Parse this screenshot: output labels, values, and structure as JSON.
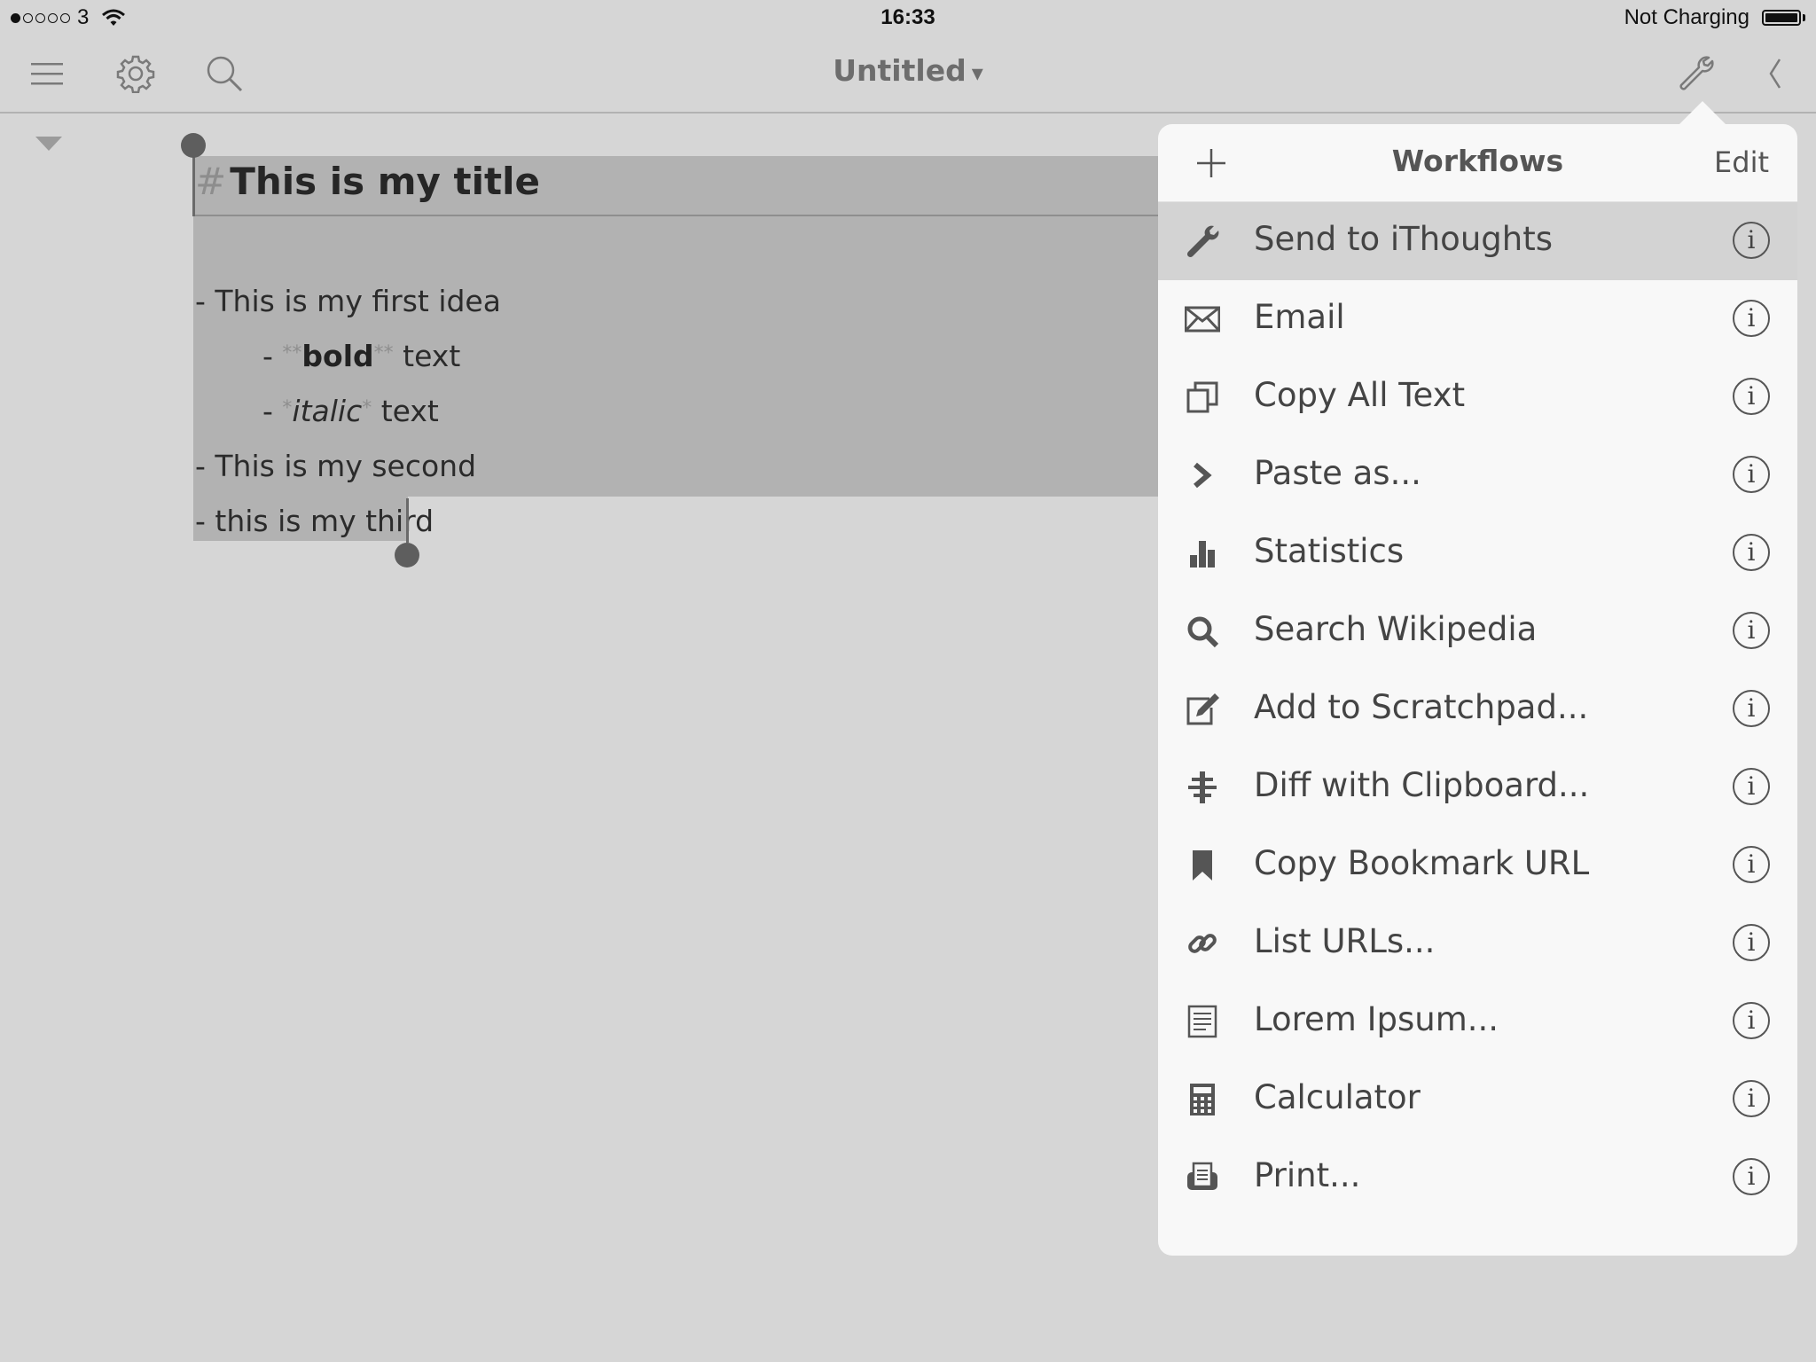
{
  "status_bar": {
    "carrier": "3",
    "time": "16:33",
    "battery_text": "Not Charging"
  },
  "toolbar": {
    "doc_title": "Untitled",
    "title_caret": "▾"
  },
  "editor": {
    "heading_marker": "#",
    "heading": "This is my title",
    "line1": "- This is my first idea",
    "line2_dash": "- ",
    "line2_mark_open": "**",
    "line2_bold": "bold",
    "line2_mark_close": "**",
    "line2_rest": " text",
    "line3_dash": "- ",
    "line3_mark_open": "*",
    "line3_italic": "italic",
    "line3_mark_close": "*",
    "line3_rest": " text",
    "line4": "- This is my second",
    "line5": "- this is my third"
  },
  "popover": {
    "title": "Workflows",
    "edit_label": "Edit",
    "info_glyph": "i",
    "items": [
      {
        "label": "Send to iThoughts",
        "icon": "wrench-icon"
      },
      {
        "label": "Email",
        "icon": "envelope-icon"
      },
      {
        "label": "Copy All Text",
        "icon": "copy-icon"
      },
      {
        "label": "Paste as...",
        "icon": "chevron-right-icon"
      },
      {
        "label": "Statistics",
        "icon": "bar-chart-icon"
      },
      {
        "label": "Search Wikipedia",
        "icon": "search-icon"
      },
      {
        "label": "Add to Scratchpad...",
        "icon": "edit-icon"
      },
      {
        "label": "Diff with Clipboard...",
        "icon": "diff-icon"
      },
      {
        "label": "Copy Bookmark URL",
        "icon": "bookmark-icon"
      },
      {
        "label": "List URLs...",
        "icon": "link-icon"
      },
      {
        "label": "Lorem Ipsum...",
        "icon": "document-lines-icon"
      },
      {
        "label": "Calculator",
        "icon": "calculator-icon"
      },
      {
        "label": "Print...",
        "icon": "printer-icon"
      }
    ]
  },
  "colors": {
    "background": "#d6d6d6",
    "selection": "#b2b2b2",
    "popover_bg": "#f8f8f8",
    "selected_row": "#d3d3d3"
  }
}
